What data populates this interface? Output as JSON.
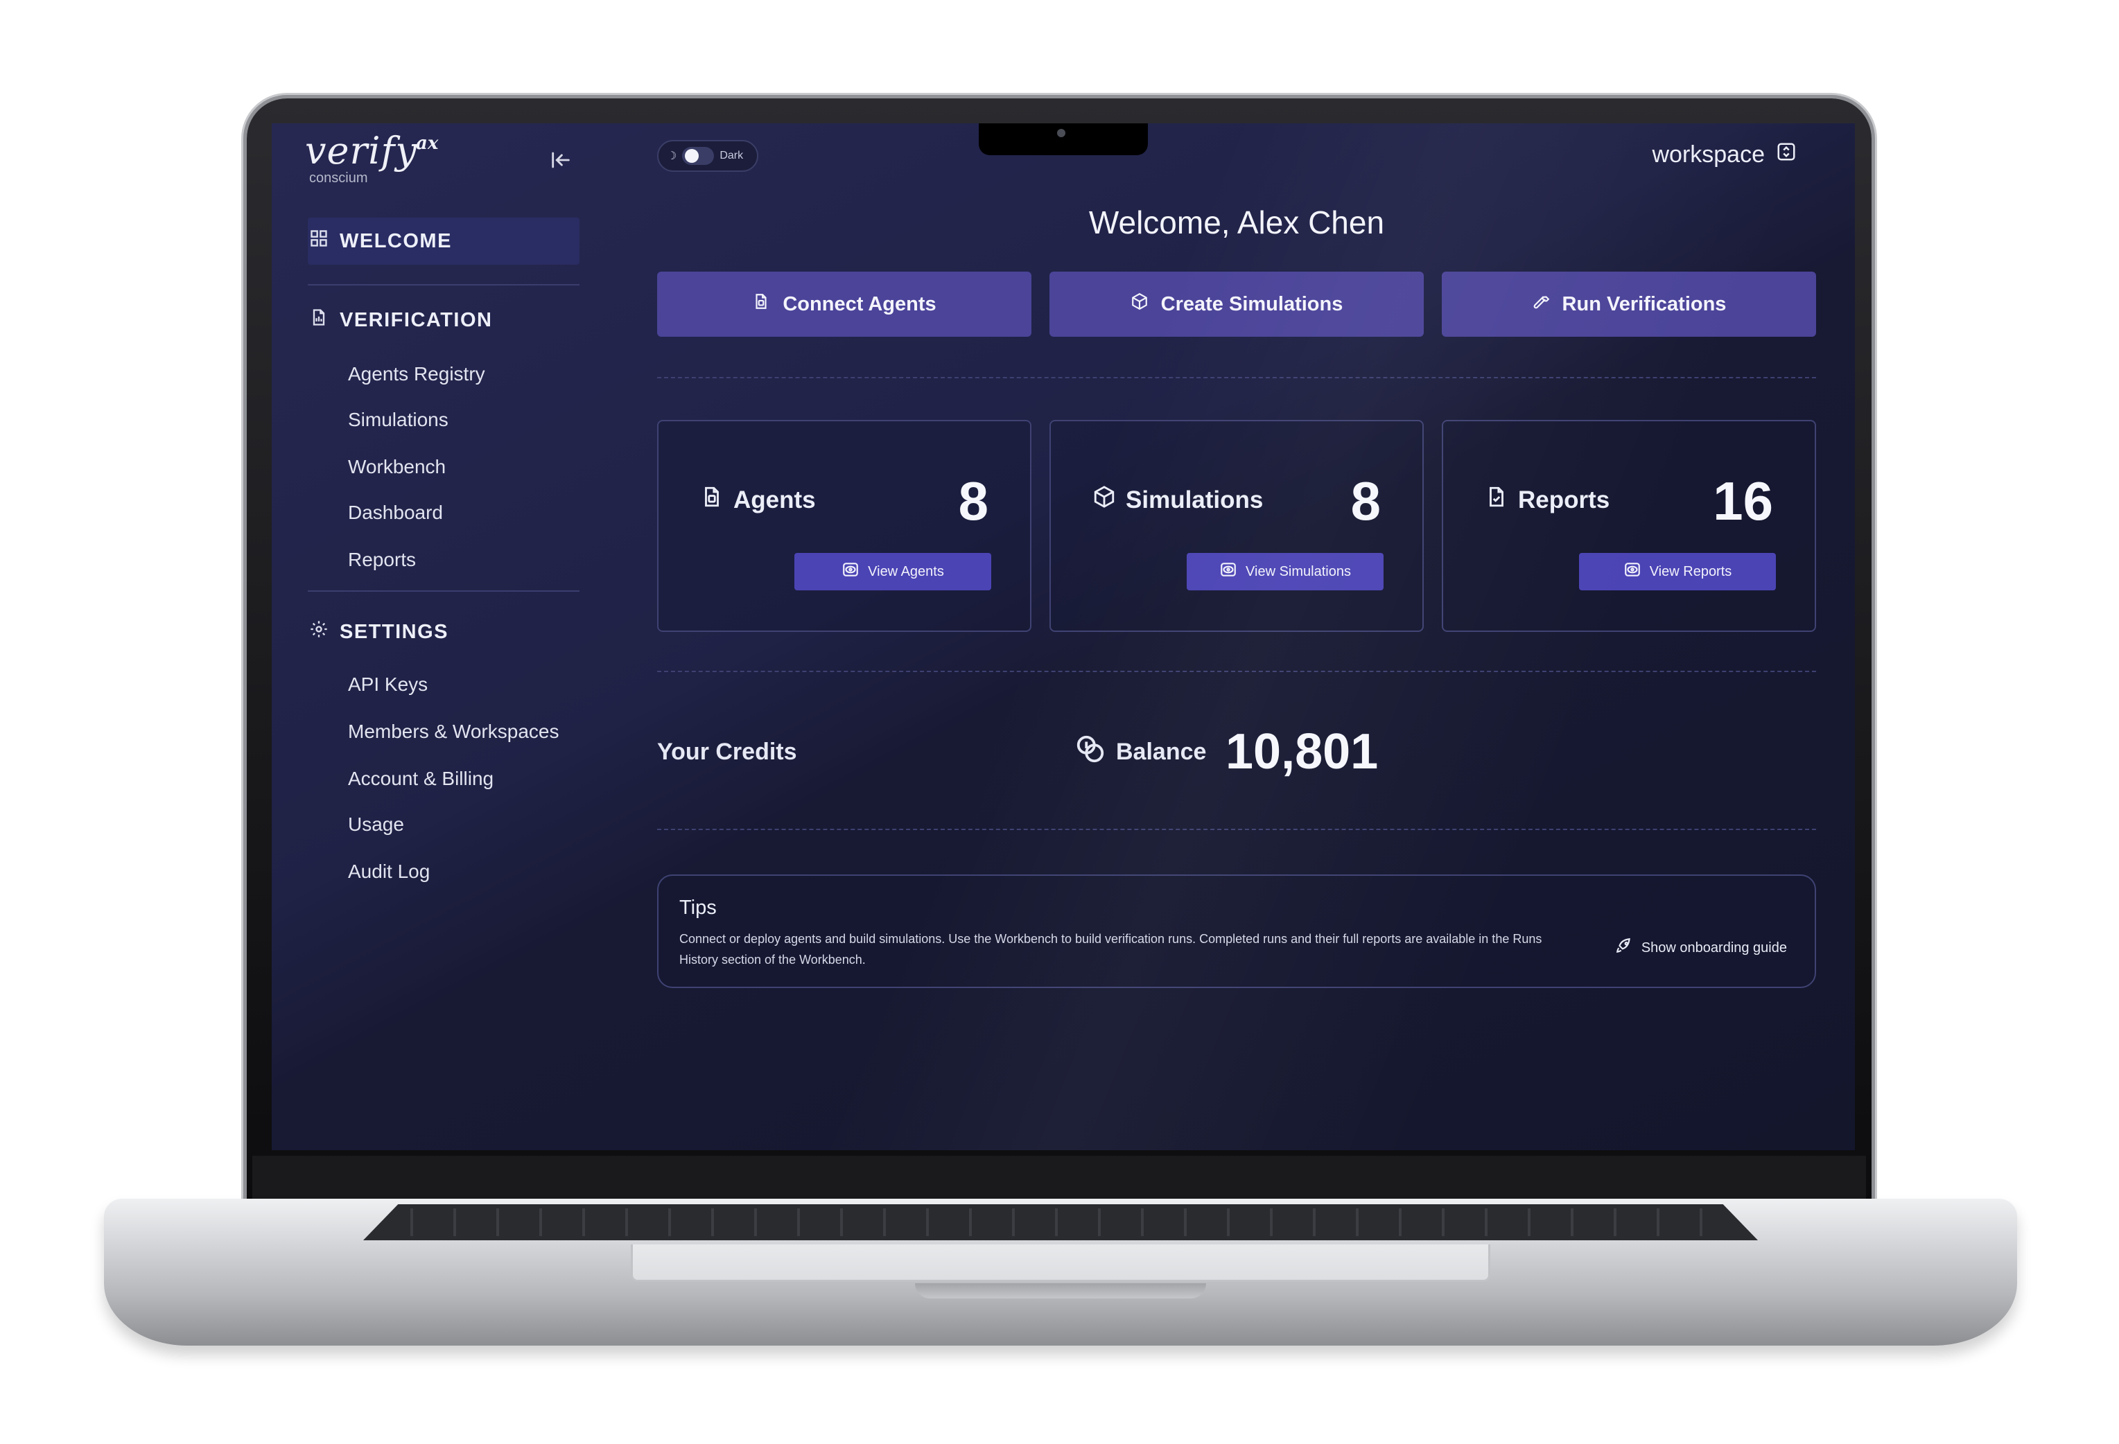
{
  "brand": {
    "name": "verify",
    "superscript": "ax",
    "subtitle": "conscium"
  },
  "sidebar": {
    "welcome": "WELCOME",
    "verification": {
      "heading": "VERIFICATION",
      "items": [
        "Agents Registry",
        "Simulations",
        "Workbench",
        "Dashboard",
        "Reports"
      ]
    },
    "settings": {
      "heading": "SETTINGS",
      "items": [
        "API Keys",
        "Members & Workspaces",
        "Account & Billing",
        "Usage",
        "Audit Log"
      ]
    }
  },
  "topbar": {
    "theme_label": "Dark",
    "workspace_label": "workspace"
  },
  "welcome": {
    "title": "Welcome,  Alex Chen"
  },
  "actions": [
    {
      "label": "Connect Agents",
      "icon": "agent-file-icon"
    },
    {
      "label": "Create Simulations",
      "icon": "cube-icon"
    },
    {
      "label": "Run Verifications",
      "icon": "wrench-icon"
    }
  ],
  "stats": [
    {
      "label": "Agents",
      "count": "8",
      "button": "View Agents",
      "icon": "agent-file-icon"
    },
    {
      "label": "Simulations",
      "count": "8",
      "button": "View Simulations",
      "icon": "cube-icon"
    },
    {
      "label": "Reports",
      "count": "16",
      "button": "View Reports",
      "icon": "report-check-icon"
    }
  ],
  "credits": {
    "label": "Your Credits",
    "balance_label": "Balance",
    "balance_value": "10,801"
  },
  "tips": {
    "title": "Tips",
    "text": "Connect or deploy agents and build simulations. Use the Workbench to build verification runs. Completed runs and their full reports are available in the Runs History section of the Workbench.",
    "link": "Show onboarding guide"
  },
  "colors": {
    "accent": "#4b4499",
    "button": "#4b44b5",
    "background": "#1f2145"
  }
}
